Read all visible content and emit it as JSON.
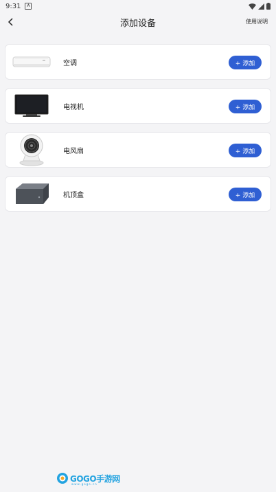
{
  "status_bar": {
    "time": "9:31",
    "notification_letter": "A"
  },
  "header": {
    "title": "添加设备",
    "help_label": "使用说明"
  },
  "devices": [
    {
      "name": "空调",
      "add_label": "+ 添加",
      "image": "air-conditioner"
    },
    {
      "name": "电视机",
      "add_label": "+ 添加",
      "image": "television"
    },
    {
      "name": "电风扇",
      "add_label": "+ 添加",
      "image": "electric-fan"
    },
    {
      "name": "机顶盒",
      "add_label": "+ 添加",
      "image": "set-top-box"
    }
  ],
  "watermark": {
    "text": "GOGO手游网",
    "sub": "www.gogo.cn"
  },
  "colors": {
    "accent": "#2f5fd3",
    "background": "#f4f4f6",
    "card": "#ffffff"
  }
}
